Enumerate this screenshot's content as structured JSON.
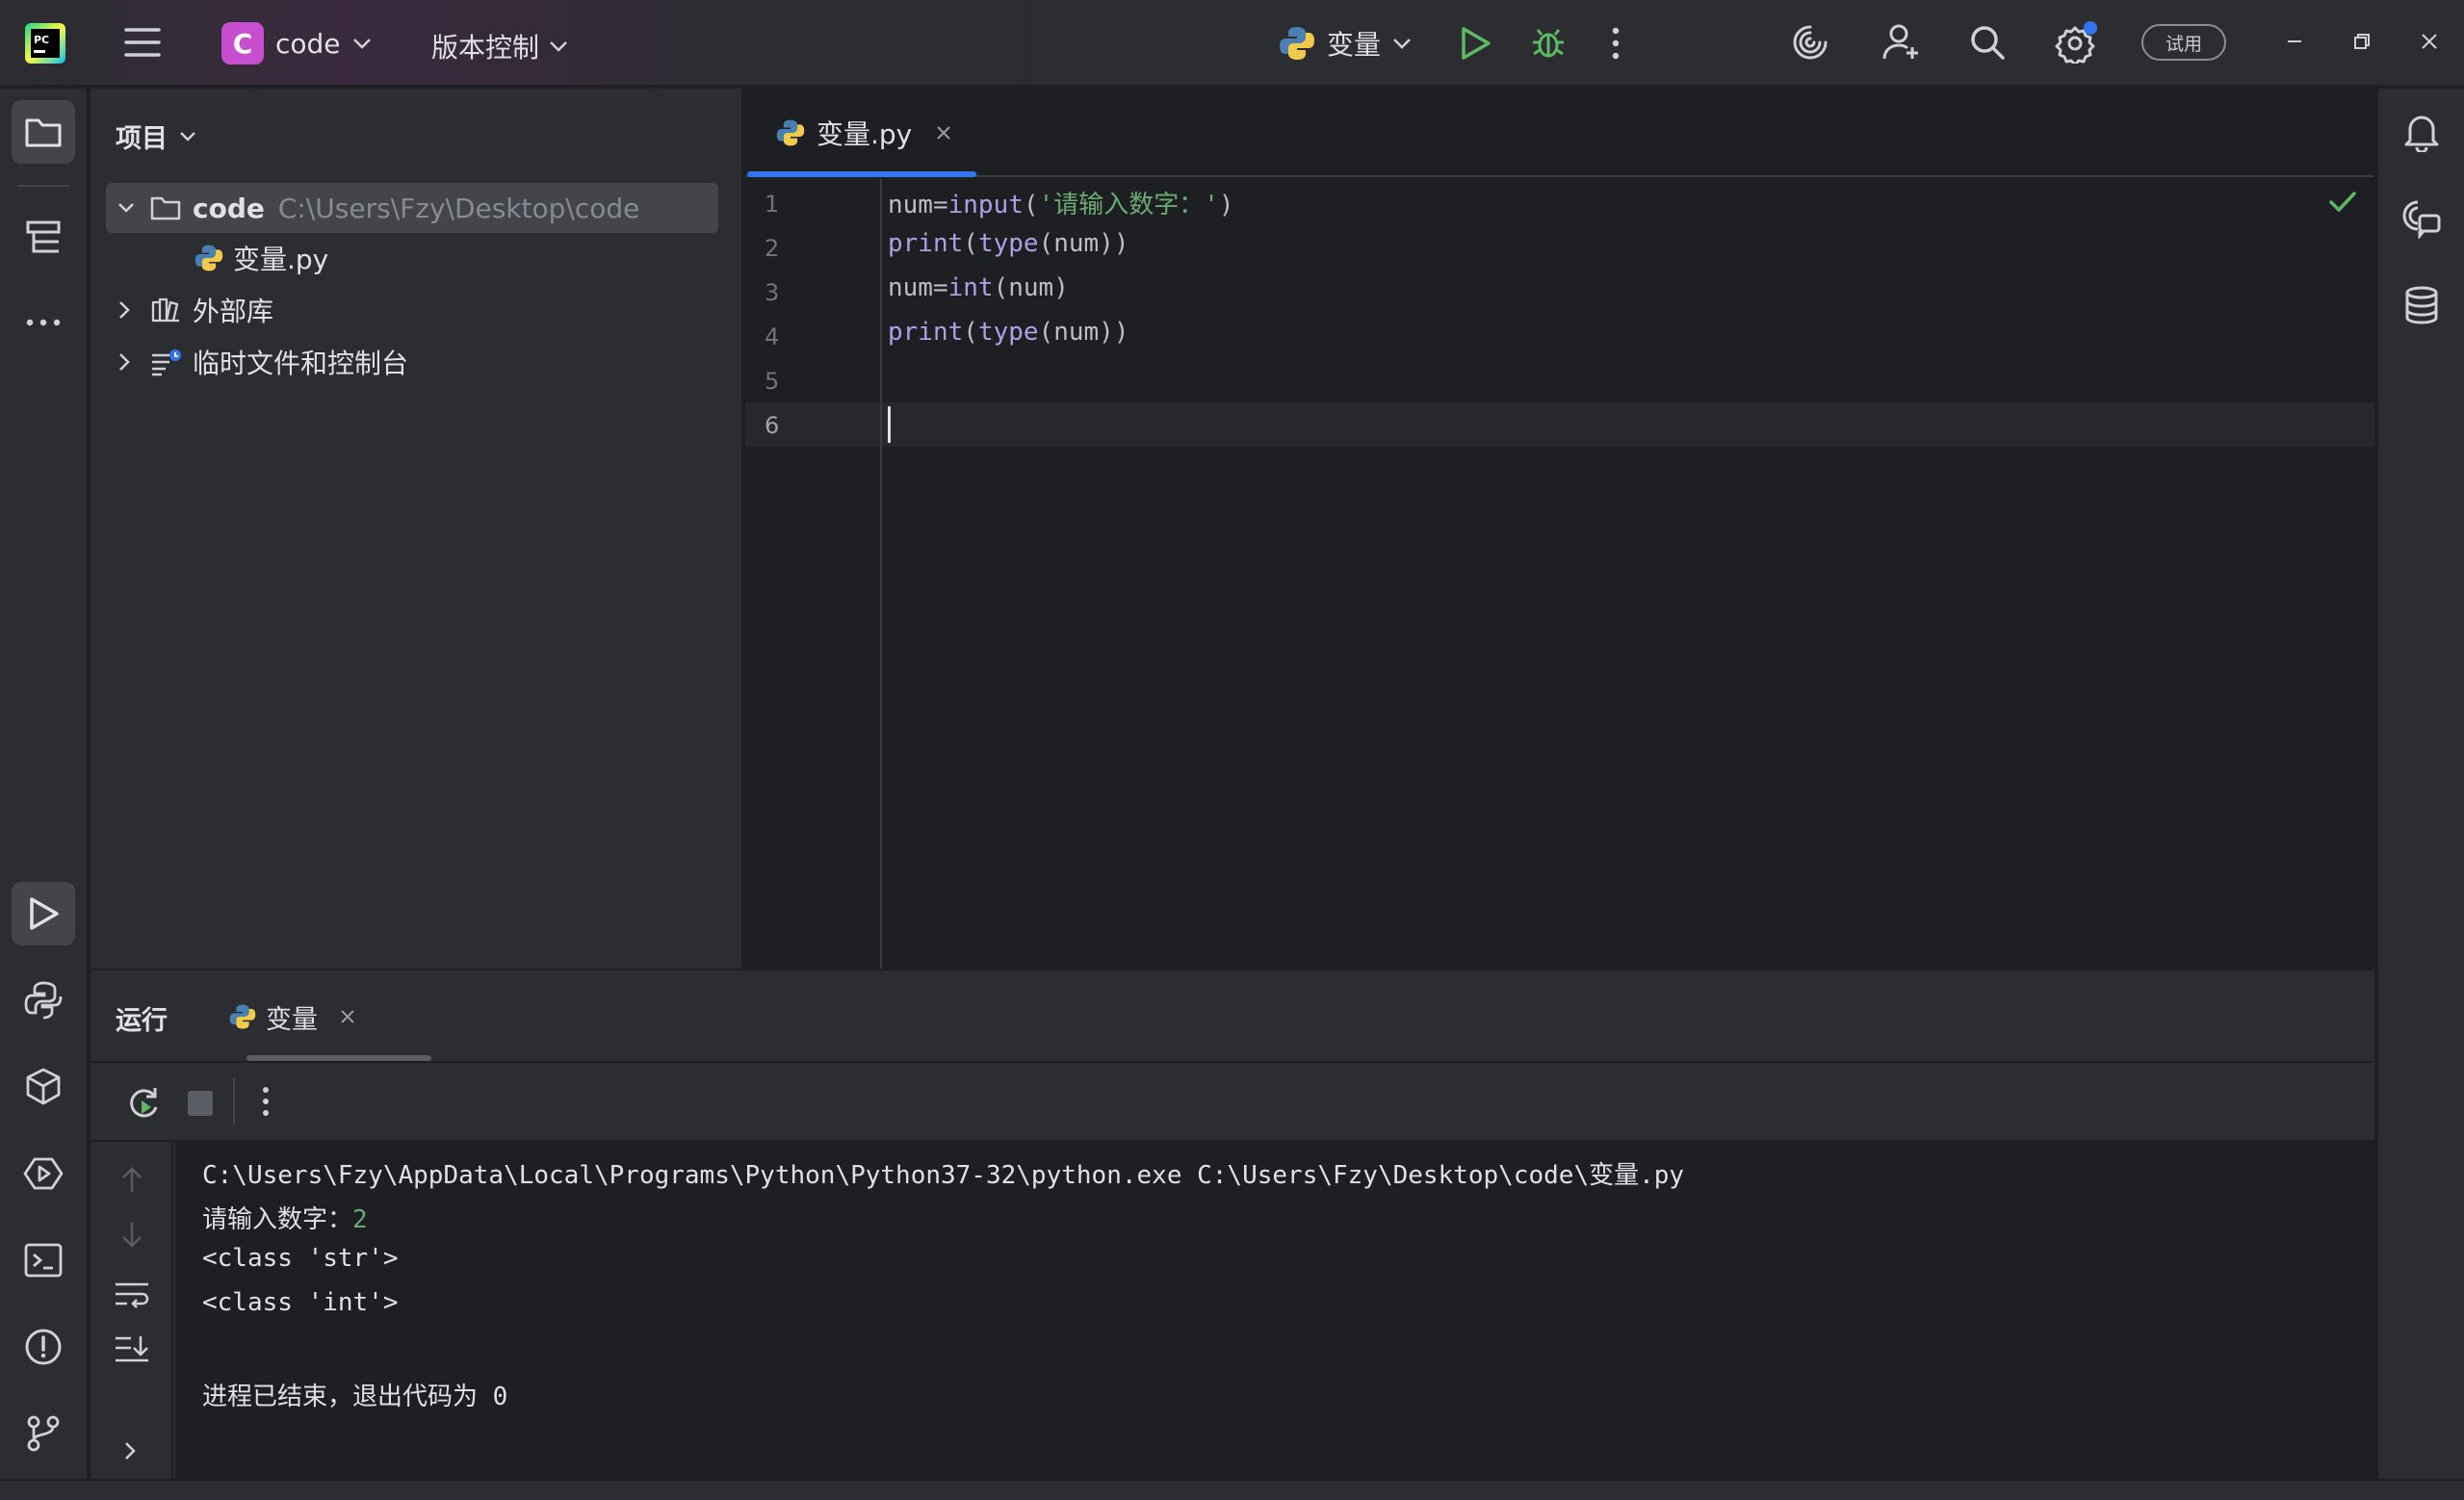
{
  "titlebar": {
    "project_badge": "C",
    "project_name": "code",
    "vcs_label": "版本控制",
    "run_config": "变量",
    "trial_label": "试用",
    "icons": [
      "pycharm-logo-icon",
      "hamburger-menu-icon",
      "chevron-down-icon",
      "python-icon",
      "run-icon",
      "debug-icon",
      "more-vert-icon",
      "ai-assistant-icon",
      "add-user-icon",
      "search-icon",
      "settings-icon",
      "minimize-icon",
      "restore-icon",
      "close-icon"
    ]
  },
  "left_strip": {
    "icons": [
      "project-folder-icon",
      "structure-icon",
      "more-horiz-icon",
      "run-icon",
      "python-console-icon",
      "python-packages-icon",
      "services-icon",
      "terminal-icon",
      "problems-icon",
      "git-icon"
    ]
  },
  "right_strip": {
    "icons": [
      "notifications-icon",
      "ai-chat-icon",
      "database-icon"
    ]
  },
  "project_panel": {
    "title": "项目",
    "tree": [
      {
        "label": "code",
        "path": "C:\\Users\\Fzy\\Desktop\\code",
        "expanded": true,
        "selected": true
      },
      {
        "label": "变量.py"
      },
      {
        "label": "外部库",
        "expanded": false
      },
      {
        "label": "临时文件和控制台",
        "expanded": false
      }
    ]
  },
  "editor": {
    "tab_label": "变量.py",
    "line_numbers": [
      "1",
      "2",
      "3",
      "4",
      "5",
      "6"
    ],
    "code": {
      "l1": {
        "a": "num=",
        "b": "input",
        "c": "(",
        "d": "'请输入数字：'",
        "e": ")"
      },
      "l2": {
        "a": "print",
        "b": "(",
        "c": "type",
        "d": "(num))"
      },
      "l3": {
        "a": "num=",
        "b": "int",
        "c": "(num)"
      },
      "l4": {
        "a": "print",
        "b": "(",
        "c": "type",
        "d": "(num))"
      }
    },
    "inspection_status": "ok",
    "accent": "#3574f0"
  },
  "run_panel": {
    "title": "运行",
    "tab_label": "变量",
    "console": {
      "command": "C:\\Users\\Fzy\\AppData\\Local\\Programs\\Python\\Python37-32\\python.exe C:\\Users\\Fzy\\Desktop\\code\\变量.py",
      "prompt": "请输入数字：",
      "input": "2",
      "out1": "<class 'str'>",
      "out2": "<class 'int'>",
      "exit": "进程已结束，退出代码为 0"
    }
  },
  "colors": {
    "background": "#1e1f22",
    "panel": "#2b2d30",
    "string": "#6aab73",
    "function": "#b09fe7",
    "run_green": "#5fb865",
    "project_badge": "#c74fcf"
  }
}
